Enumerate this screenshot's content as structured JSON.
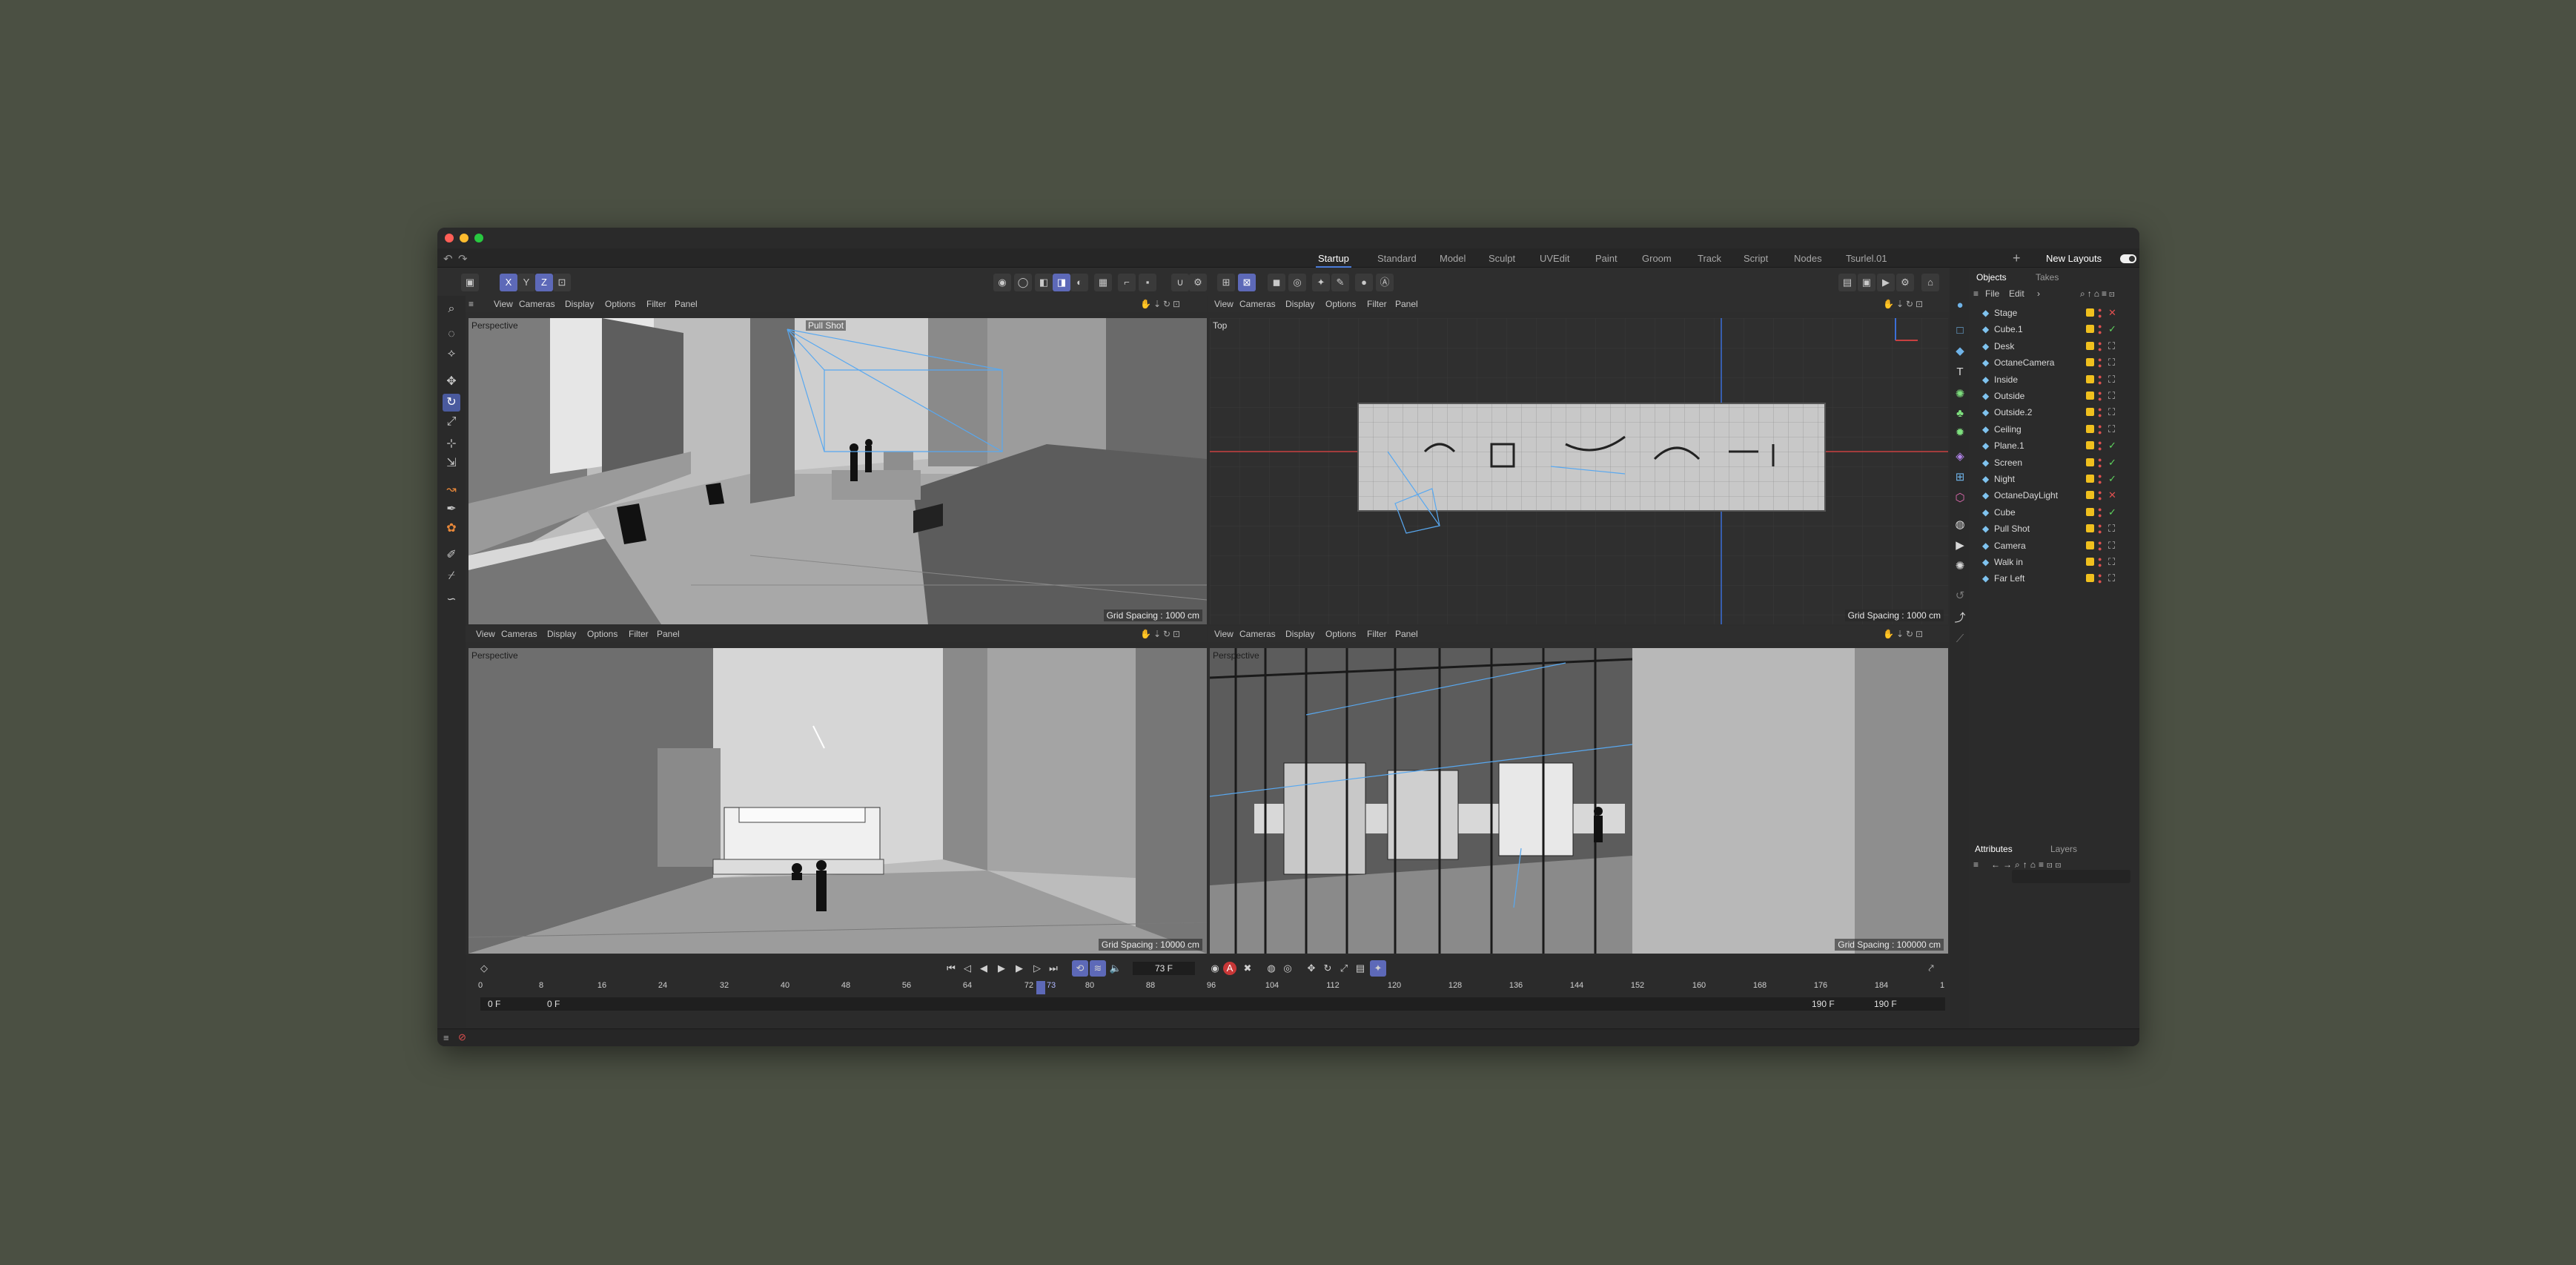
{
  "menubar": {
    "layouts": [
      "Startup",
      "Standard",
      "Model",
      "Sculpt",
      "UVEdit",
      "Paint",
      "Groom",
      "Track",
      "Script",
      "Nodes",
      "Tsurlel.01"
    ],
    "active_layout": "Startup",
    "new_layouts": "New Layouts"
  },
  "toolbar": {
    "axis_x": "X",
    "axis_y": "Y",
    "axis_z": "Z"
  },
  "viewport_menu": [
    "View",
    "Cameras",
    "Display",
    "Options",
    "Filter",
    "Panel"
  ],
  "viewports": {
    "tl": {
      "label": "Perspective",
      "grid": "Grid Spacing : 1000 cm",
      "camera_tag": "Pull Shot"
    },
    "tr": {
      "label": "Top",
      "grid": "Grid Spacing : 1000 cm"
    },
    "bl": {
      "label": "Perspective",
      "grid": "Grid Spacing : 10000 cm"
    },
    "br": {
      "label": "Perspective",
      "grid": "Grid Spacing : 100000 cm"
    }
  },
  "timeline": {
    "current_frame": "73 F",
    "start": "0 F",
    "range_start": "0 F",
    "range_end": "190 F",
    "end": "190 F",
    "ticks": [
      "0",
      "8",
      "16",
      "24",
      "32",
      "40",
      "48",
      "56",
      "64",
      "72",
      "80",
      "88",
      "96",
      "104",
      "112",
      "120",
      "128",
      "136",
      "144",
      "152",
      "160",
      "168",
      "176",
      "184",
      "1"
    ],
    "playhead_label": "73"
  },
  "objects_panel": {
    "tabs": [
      "Objects",
      "Takes"
    ],
    "menu": [
      "File",
      "Edit"
    ],
    "objects": [
      {
        "name": "Stage",
        "status": "no"
      },
      {
        "name": "Cube.1",
        "status": "ok"
      },
      {
        "name": "Desk",
        "status": "gr"
      },
      {
        "name": "OctaneCamera",
        "status": "gr"
      },
      {
        "name": "Inside",
        "status": "gr"
      },
      {
        "name": "Outside",
        "status": "gr"
      },
      {
        "name": "Outside.2",
        "status": "gr"
      },
      {
        "name": "Ceiling",
        "status": "gr"
      },
      {
        "name": "Plane.1",
        "status": "ok"
      },
      {
        "name": "Screen",
        "status": "ok"
      },
      {
        "name": "Night",
        "status": "ok"
      },
      {
        "name": "OctaneDayLight",
        "status": "no"
      },
      {
        "name": "Cube",
        "status": "ok"
      },
      {
        "name": "Pull Shot",
        "status": "gr"
      },
      {
        "name": "Camera",
        "status": "gr"
      },
      {
        "name": "Walk in",
        "status": "gr"
      },
      {
        "name": "Far Left",
        "status": "gr"
      }
    ]
  },
  "attributes_panel": {
    "tabs": [
      "Attributes",
      "Layers"
    ]
  },
  "colors": {
    "accent": "#5d69b8",
    "swatch": "#f0c01e",
    "ok": "#5ed45e",
    "no": "#e05050"
  }
}
